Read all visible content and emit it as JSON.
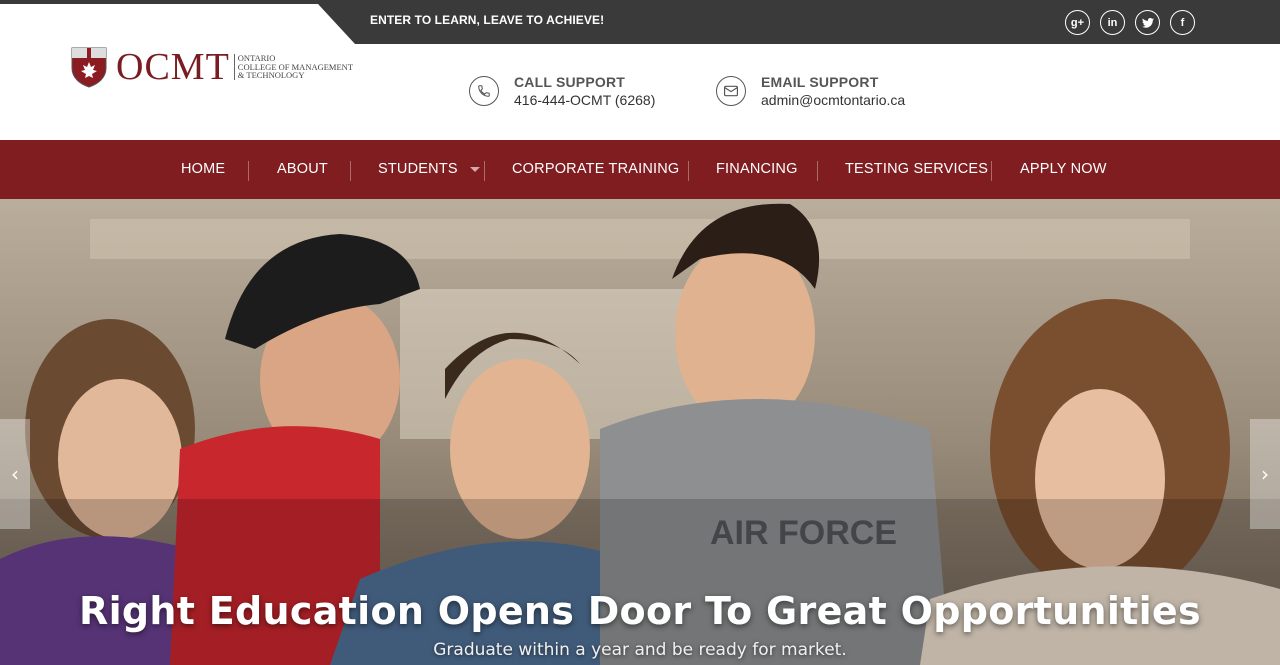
{
  "topbar": {
    "tagline": "ENTER TO LEARN, LEAVE TO ACHIEVE!",
    "social": [
      {
        "icon": "google-plus-icon",
        "glyph": "g+"
      },
      {
        "icon": "linkedin-icon",
        "glyph": "in"
      },
      {
        "icon": "twitter-icon",
        "glyph": "t"
      },
      {
        "icon": "facebook-icon",
        "glyph": "f"
      }
    ]
  },
  "logo": {
    "wordmark": "OCMT",
    "line1": "Ontario",
    "line2": "College of Management",
    "line3": "& Technology"
  },
  "contact": {
    "call_title": "CALL SUPPORT",
    "call_value": "416-444-OCMT (6268)",
    "email_title": "EMAIL SUPPORT",
    "email_value": "admin@ocmtontario.ca"
  },
  "nav": {
    "items": [
      "HOME",
      "ABOUT",
      "STUDENTS",
      "CORPORATE TRAINING",
      "FINANCING",
      "TESTING SERVICES",
      "APPLY NOW"
    ]
  },
  "hero": {
    "title": "Right Education Opens Door To Great Opportunities",
    "subtitle": "Graduate within a year and be ready for market.",
    "prev_glyph": "‹",
    "next_glyph": "›"
  },
  "colors": {
    "brand": "#7f1d20",
    "topbar": "#3a3a3a"
  }
}
